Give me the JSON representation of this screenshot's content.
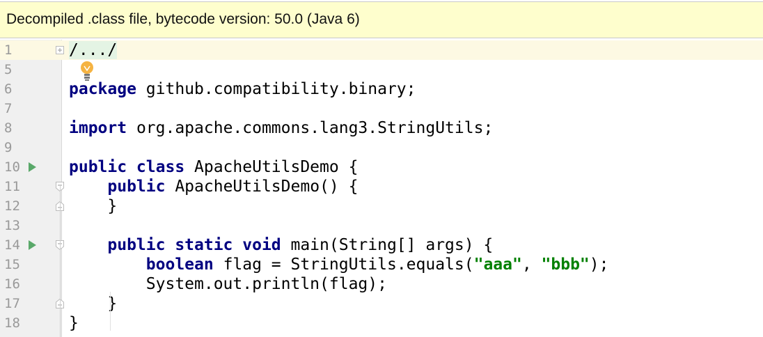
{
  "banner": {
    "text": "Decompiled .class file, bytecode version: 50.0 (Java 6)"
  },
  "colors": {
    "keyword": "#000080",
    "string": "#008000",
    "run": "#59a869",
    "banner_bg": "#fefecd"
  },
  "lines": [
    {
      "n": "1",
      "tokens": [
        {
          "t": "/.../",
          "c": "fold"
        }
      ],
      "current": true,
      "mark": "fold-expand"
    },
    {
      "n": "5",
      "tokens": []
    },
    {
      "n": "6",
      "tokens": [
        {
          "t": "package",
          "c": "kw"
        },
        {
          "t": " github.compatibility.binary;"
        }
      ]
    },
    {
      "n": "7",
      "tokens": []
    },
    {
      "n": "8",
      "tokens": [
        {
          "t": "import",
          "c": "kw"
        },
        {
          "t": " org.apache.commons.lang3.StringUtils;"
        }
      ]
    },
    {
      "n": "9",
      "tokens": []
    },
    {
      "n": "10",
      "tokens": [
        {
          "t": "public class",
          "c": "kw"
        },
        {
          "t": " ApacheUtilsDemo {"
        }
      ],
      "run": true
    },
    {
      "n": "11",
      "tokens": [
        {
          "t": "    "
        },
        {
          "t": "public",
          "c": "kw"
        },
        {
          "t": " ApacheUtilsDemo() {"
        }
      ],
      "mark": "fold-start"
    },
    {
      "n": "12",
      "tokens": [
        {
          "t": "    }"
        }
      ],
      "mark": "fold-end"
    },
    {
      "n": "13",
      "tokens": []
    },
    {
      "n": "14",
      "tokens": [
        {
          "t": "    "
        },
        {
          "t": "public static void",
          "c": "kw"
        },
        {
          "t": " main(String[] args) {"
        }
      ],
      "run": true,
      "mark": "fold-start"
    },
    {
      "n": "15",
      "tokens": [
        {
          "t": "        "
        },
        {
          "t": "boolean",
          "c": "kw"
        },
        {
          "t": " flag = StringUtils.equals("
        },
        {
          "t": "\"aaa\"",
          "c": "str"
        },
        {
          "t": ", "
        },
        {
          "t": "\"bbb\"",
          "c": "str"
        },
        {
          "t": ");"
        }
      ]
    },
    {
      "n": "16",
      "tokens": [
        {
          "t": "        System.out.println(flag);"
        }
      ]
    },
    {
      "n": "17",
      "tokens": [
        {
          "t": "    }"
        }
      ],
      "mark": "fold-end"
    },
    {
      "n": "18",
      "tokens": [
        {
          "t": "}"
        }
      ]
    }
  ]
}
